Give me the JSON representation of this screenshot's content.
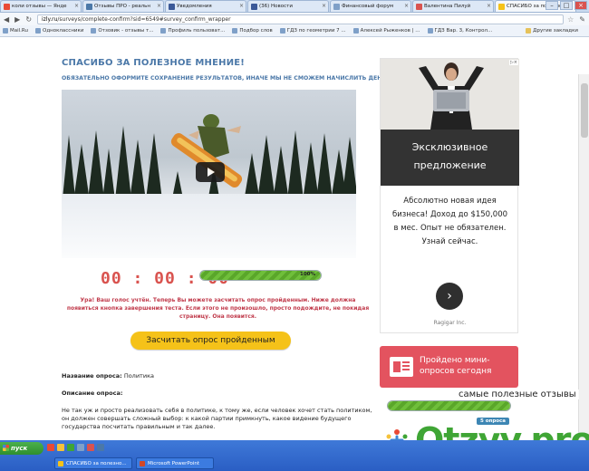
{
  "tabs": [
    {
      "label": "коли отзывы — Янде",
      "color": "#e94a35",
      "active": false
    },
    {
      "label": "Отзывы ПРО - реальн",
      "color": "#4b78a8",
      "active": false
    },
    {
      "label": "Уведомления",
      "color": "#3b5998",
      "active": false
    },
    {
      "label": "(36) Новости",
      "color": "#3b5998",
      "active": false
    },
    {
      "label": "Финансовый форум",
      "color": "#7fa0c8",
      "active": false
    },
    {
      "label": "Валентина Пилуй",
      "color": "#d9534f",
      "active": false
    },
    {
      "label": "СПАСИБО за полезно",
      "color": "#f5c219",
      "active": true
    }
  ],
  "address": {
    "host": "izly.ru",
    "path": "/surveys/complete-confirm?sid=6549#survey_confirm_wrapper"
  },
  "bookmarks": [
    "Mail.Ru",
    "Одноклассники",
    "Отзовик - отзывы т...",
    "Профиль пользоват...",
    "Подбор слов",
    "ГДЗ по геометрии 7 ...",
    "Алексей Рыженков | ...",
    "ГДЗ Вар. 3, Контрол..."
  ],
  "bookmarks_other": "Другие закладки",
  "page": {
    "title": "СПАСИБО ЗА ПОЛЕЗНОЕ МНЕНИЕ!",
    "subtitle": "ОБЯЗАТЕЛЬНО ОФОРМИТЕ СОХРАНЕНИЕ РЕЗУЛЬТАТОВ, ИНАЧЕ МЫ НЕ СМОЖЕМ НАЧИСЛИТЬ ДЕНЬГИ",
    "timer": "00 : 00 : 00",
    "progress_label": "100%",
    "progress": 1.0,
    "notice": "Ура! Ваш голос учтён. Теперь Вы можете засчитать опрос пройденным. Ниже должна появиться кнопка завершения теста. Если этого не произошло, просто подождите, не покидая страницу. Она появится.",
    "cta_label": "Засчитать опрос пройденным",
    "survey_name_label": "Название опроса:",
    "survey_name_value": "Политика",
    "survey_desc_label": "Описание опроса:",
    "survey_desc_text": "Не так уж и просто реализовать себя в политике, к тому же, если человек хочет стать политиком, он должен совершать сложный выбор: к какой партии примкнуть, какое видение будущего государства посчитать правильным и так далее."
  },
  "ad": {
    "headline_1": "Эксклюзивное",
    "headline_2": "предложение",
    "body_1": "Абсолютно новая идея",
    "body_2": "бизнеса! Доход до $150,000",
    "body_3": "в мес. Опыт не обязателен.",
    "body_4": "Узнай сейчас.",
    "brand": "Ragigar Inc."
  },
  "widget": {
    "title_1": "Пройдено мини-",
    "title_2": "опросов сегодня",
    "count_label": "5 опроса",
    "progress": 1.0
  },
  "watermark": {
    "tagline": "самые полезные отзывы",
    "brand": "Otzyv.pro"
  },
  "taskbar": {
    "start_label": "пуск",
    "windows": [
      {
        "label": "СПАСИБО за полезно...",
        "color": "#f5c219"
      },
      {
        "label": "Microsoft PowerPoint",
        "color": "#d24726"
      }
    ]
  }
}
